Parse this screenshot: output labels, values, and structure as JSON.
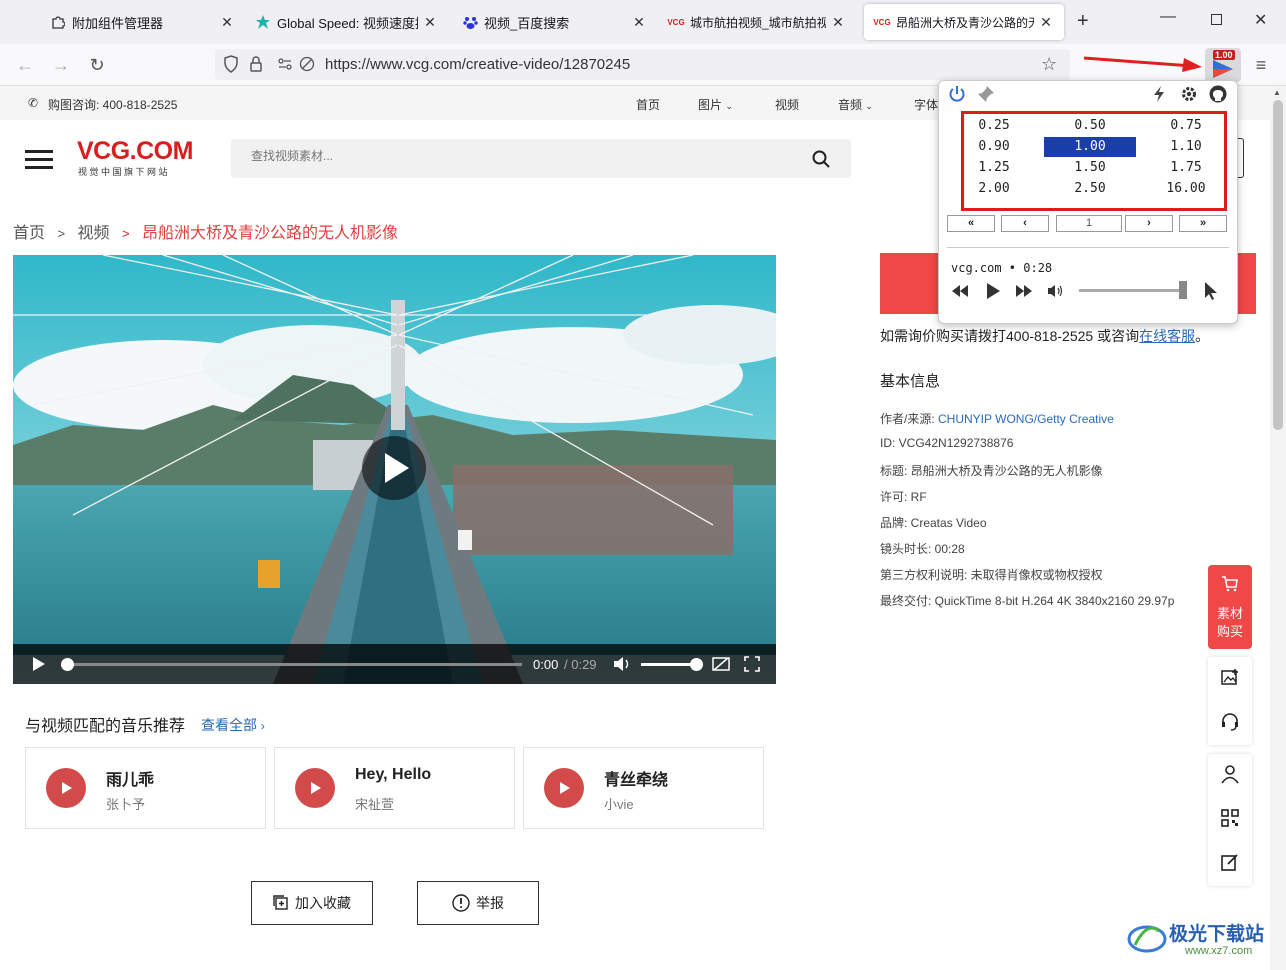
{
  "browser": {
    "tabs": [
      {
        "label": "附加组件管理器",
        "icon": "puzzle-icon"
      },
      {
        "label": "Global Speed: 视频速度控制",
        "icon": "global-speed-icon"
      },
      {
        "label": "视频_百度搜索",
        "icon": "baidu-paw-icon"
      },
      {
        "label": "城市航拍视频_城市航拍视频",
        "icon": "vcg-icon",
        "icon_text": "VCG"
      },
      {
        "label": "昂船洲大桥及青沙公路的无人",
        "icon": "vcg-icon",
        "icon_text": "VCG",
        "active": true
      }
    ],
    "url": "https://www.vcg.com/creative-video/12870245",
    "extension_badge": "1.00"
  },
  "site": {
    "phone": "购图咨询: 400-818-2525",
    "nav": [
      "首页",
      "图片",
      "视频",
      "音频",
      "字体"
    ],
    "logo": "VCG.COM",
    "logo_sub": "视 觉 中 国 旗 下 网 站",
    "search_placeholder": "查找视频素材..."
  },
  "breadcrumb": {
    "home": "首页",
    "sep": ">",
    "section": "视频",
    "current": "昂船洲大桥及青沙公路的无人机影像"
  },
  "player": {
    "time_current": "0:00",
    "time_total": "/ 0:29",
    "progress": 0.0,
    "volume": 1.0
  },
  "music": {
    "title": "与视频匹配的音乐推荐",
    "view_all": "查看全部",
    "items": [
      {
        "name": "雨儿乖",
        "artist": "张卜予"
      },
      {
        "name": "Hey, Hello",
        "artist": "宋祉萱"
      },
      {
        "name": "青丝牵绕",
        "artist": "小vie"
      }
    ]
  },
  "actions": {
    "favorite": "加入收藏",
    "report": "举报"
  },
  "sidebar": {
    "price_tip_prefix": "如需询价购买请拨打400-818-2525 或咨询",
    "price_tip_link": "在线客服",
    "price_tip_suffix": "。",
    "info_title": "基本信息",
    "info": [
      {
        "label": "作者/来源: ",
        "value": "CHUNYIP WONG/Getty Creative",
        "link": true
      },
      {
        "label": "ID: ",
        "value": "VCG42N1292738876"
      },
      {
        "label": "标题: ",
        "value": "昂船洲大桥及青沙公路的无人机影像"
      },
      {
        "label": "许可: ",
        "value": "RF"
      },
      {
        "label": "品牌: ",
        "value": "Creatas Video"
      },
      {
        "label": "镜头时长: ",
        "value": "00:28"
      },
      {
        "label": "第三方权利说明: ",
        "value": "未取得肖像权或物权授权"
      },
      {
        "label": "最终交付: ",
        "value": "QuickTime 8-bit H.264 4K 3840x2160 29.97p"
      }
    ],
    "buy_label_1": "素材",
    "buy_label_2": "购买"
  },
  "popup": {
    "speeds": [
      "0.25",
      "0.50",
      "0.75",
      "0.90",
      "1.00",
      "1.10",
      "1.25",
      "1.50",
      "1.75",
      "2.00",
      "2.50",
      "16.00"
    ],
    "selected": "1.00",
    "page_value": "1",
    "media_line": "vcg.com • 0:28",
    "volume": 1.0
  },
  "watermark": {
    "title": "极光下载站",
    "url": "www.xz7.com"
  },
  "colors": {
    "brand_red": "#d81e1e",
    "accent_blue": "#2a6ab7",
    "speed_selected": "#1a3fa8"
  }
}
